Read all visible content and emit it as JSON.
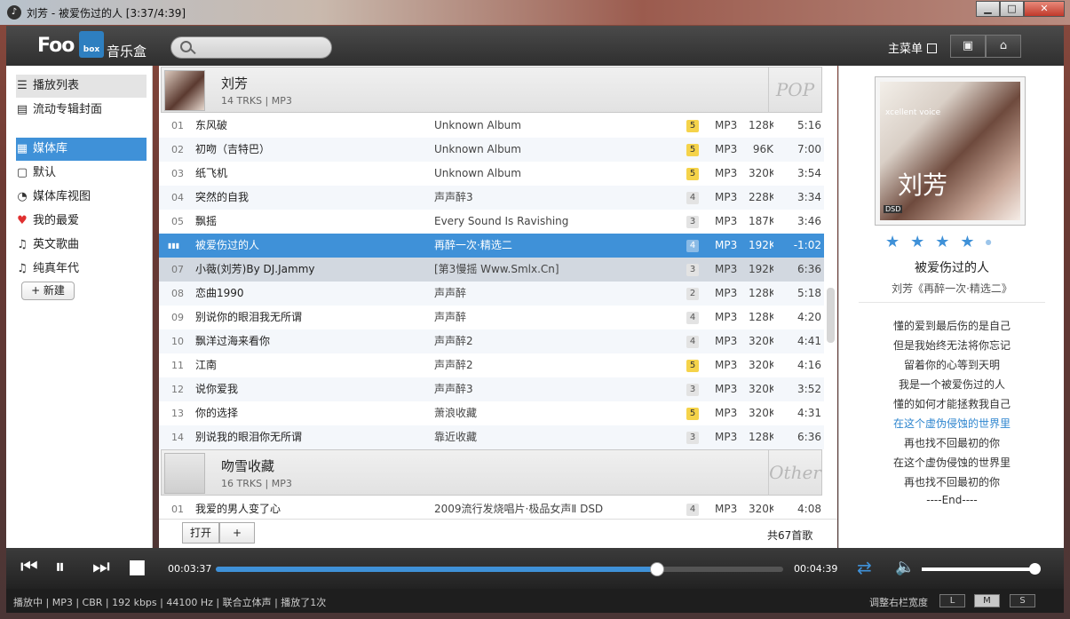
{
  "window": {
    "title": "刘芳 - 被爱伤过的人 [3:37/4:39]",
    "buttons": {
      "minimize": "▁",
      "maximize": "□",
      "close": "✕"
    }
  },
  "header": {
    "logo": "Foo",
    "logo_box": "box",
    "app_name": "音乐盒",
    "search_placeholder": "",
    "main_menu": "主菜单"
  },
  "sidebar": {
    "top_items": [
      {
        "label": "播放列表",
        "icon": "playlist-icon"
      },
      {
        "label": "流动专辑封面",
        "icon": "coverflow-icon"
      }
    ],
    "items": [
      {
        "label": "媒体库",
        "icon": "library-icon",
        "selected": true
      },
      {
        "label": "默认",
        "icon": "document-icon"
      },
      {
        "label": "媒体库视图",
        "icon": "view-icon"
      },
      {
        "label": "我的最爱",
        "icon": "heart-icon"
      },
      {
        "label": "英文歌曲",
        "icon": "note-icon"
      },
      {
        "label": "纯真年代",
        "icon": "note-icon"
      }
    ],
    "new_button": "+ 新建"
  },
  "playlist": {
    "groups": [
      {
        "name": "刘芳",
        "sub": "14 TRKS | MP3",
        "genre": "POP",
        "tracks": [
          {
            "num": "01",
            "title": "东风破",
            "album": "Unknown Album",
            "rating": "5",
            "format": "MP3",
            "bitrate": "128K",
            "duration": "5:16"
          },
          {
            "num": "02",
            "title": "初吻（吉特巴）",
            "album": "Unknown Album",
            "rating": "5",
            "format": "MP3",
            "bitrate": "96K",
            "duration": "7:00"
          },
          {
            "num": "03",
            "title": "纸飞机",
            "album": "Unknown Album",
            "rating": "5",
            "format": "MP3",
            "bitrate": "320K",
            "duration": "3:54"
          },
          {
            "num": "04",
            "title": "突然的自我",
            "album": "声声醉3",
            "rating": "4",
            "format": "MP3",
            "bitrate": "228K",
            "duration": "3:34"
          },
          {
            "num": "05",
            "title": "飘摇",
            "album": "Every Sound Is Ravishing",
            "rating": "3",
            "format": "MP3",
            "bitrate": "187K",
            "duration": "3:46"
          },
          {
            "num": "",
            "title": "被爱伤过的人",
            "album": "再醉一次·精选二",
            "rating": "4",
            "format": "MP3",
            "bitrate": "192K",
            "duration": "-1:02"
          },
          {
            "num": "07",
            "title": "小薇(刘芳)By DJ.Jammy",
            "album": "[第3慢摇 Www.Smlx.Cn]",
            "rating": "3",
            "format": "MP3",
            "bitrate": "192K",
            "duration": "6:36"
          },
          {
            "num": "08",
            "title": "恋曲1990",
            "album": "声声醉",
            "rating": "2",
            "format": "MP3",
            "bitrate": "128K",
            "duration": "5:18"
          },
          {
            "num": "09",
            "title": "别说你的眼泪我无所谓",
            "album": "声声醉",
            "rating": "4",
            "format": "MP3",
            "bitrate": "128K",
            "duration": "4:20"
          },
          {
            "num": "10",
            "title": "飘洋过海来看你",
            "album": "声声醉2",
            "rating": "4",
            "format": "MP3",
            "bitrate": "320K",
            "duration": "4:41"
          },
          {
            "num": "11",
            "title": "江南",
            "album": "声声醉2",
            "rating": "5",
            "format": "MP3",
            "bitrate": "320K",
            "duration": "4:16"
          },
          {
            "num": "12",
            "title": "说你爱我",
            "album": "声声醉3",
            "rating": "3",
            "format": "MP3",
            "bitrate": "320K",
            "duration": "3:52"
          },
          {
            "num": "13",
            "title": "你的选择",
            "album": "萧浪收藏",
            "rating": "5",
            "format": "MP3",
            "bitrate": "320K",
            "duration": "4:31"
          },
          {
            "num": "14",
            "title": "别说我的眼泪你无所谓",
            "album": "靠近收藏",
            "rating": "3",
            "format": "MP3",
            "bitrate": "128K",
            "duration": "6:36"
          }
        ]
      },
      {
        "name": "吻雪收藏",
        "sub": "16 TRKS | MP3",
        "genre": "Other",
        "tracks": [
          {
            "num": "01",
            "title": "我爱的男人变了心",
            "album": "2009流行发烧唱片·极品女声Ⅱ DSD",
            "rating": "4",
            "format": "MP3",
            "bitrate": "320K",
            "duration": "4:08"
          }
        ]
      }
    ],
    "open_button": "打开",
    "add_button": "+",
    "total": "共67首歌"
  },
  "now_playing": {
    "cover_text": "刘芳",
    "cover_label": "DSD",
    "cover_tagline": "xcellent voice",
    "rating": 4,
    "title": "被爱伤过的人",
    "artist_album": "刘芳《再醉一次·精选二》",
    "lyrics": [
      "懂的爱到最后伤的是自己",
      "但是我始终无法将你忘记",
      "留着你的心等到天明",
      "我是一个被爱伤过的人",
      "懂的如何才能拯救我自己",
      "在这个虚伪侵蚀的世界里",
      "再也找不回最初的你",
      "在这个虚伪侵蚀的世界里",
      "再也找不回最初的你",
      "----End----"
    ],
    "active_lyric_index": 5
  },
  "transport": {
    "elapsed": "00:03:37",
    "total": "00:04:39",
    "progress": 0.778,
    "volume": 0.97
  },
  "status": {
    "text": "播放中 | MP3 | CBR | 192 kbps | 44100 Hz | 联合立体声 | 播放了1次",
    "width_label": "调整右栏宽度",
    "size_buttons": [
      "L",
      "M",
      "S"
    ],
    "size_selected": "M"
  },
  "colors": {
    "accent": "#3f91d8",
    "rating_gold": "#f5d34a"
  }
}
